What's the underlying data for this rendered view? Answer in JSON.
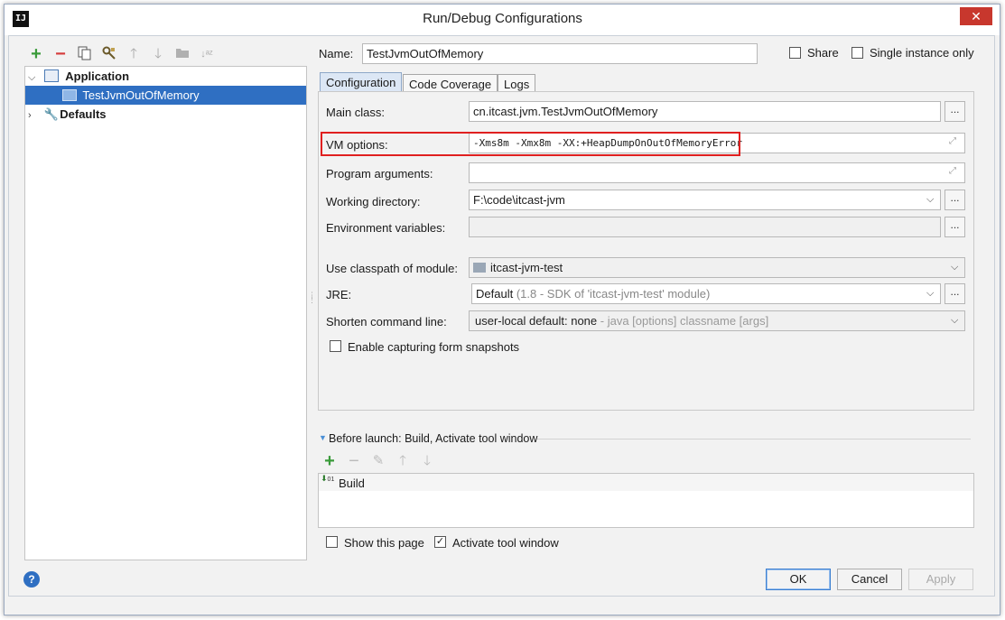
{
  "window": {
    "title": "Run/Debug Configurations",
    "app_icon_text": "IJ",
    "close_symbol": "✕"
  },
  "toolbar": {
    "icons": [
      "add-icon",
      "remove-icon",
      "copy-icon",
      "edit-defaults-icon",
      "move-up-icon",
      "move-down-icon",
      "folder-icon",
      "sort-icon"
    ]
  },
  "tree": {
    "application": "Application",
    "selected_item": "TestJvmOutOfMemory",
    "defaults": "Defaults"
  },
  "name_row": {
    "label": "Name:",
    "value": "TestJvmOutOfMemory",
    "share_label": "Share",
    "single_instance_label": "Single instance only"
  },
  "tabs": [
    "Configuration",
    "Code Coverage",
    "Logs"
  ],
  "config": {
    "main_class_label": "Main class:",
    "main_class_value": "cn.itcast.jvm.TestJvmOutOfMemory",
    "vm_options_label": "VM options:",
    "vm_options_value": "-Xms8m -Xmx8m -XX:+HeapDumpOnOutOfMemoryError",
    "program_args_label": "Program arguments:",
    "program_args_value": "",
    "working_dir_label": "Working directory:",
    "working_dir_value": "F:\\code\\itcast-jvm",
    "env_vars_label": "Environment variables:",
    "env_vars_value": "",
    "classpath_label": "Use classpath of module:",
    "classpath_value": "itcast-jvm-test",
    "jre_label": "JRE:",
    "jre_value_main": "Default",
    "jre_value_hint": "(1.8 - SDK of 'itcast-jvm-test' module)",
    "shorten_label": "Shorten command line:",
    "shorten_value_main": "user-local default: none",
    "shorten_value_hint": "- java [options] classname [args]",
    "capture_label": "Enable capturing form snapshots",
    "dots": "..."
  },
  "before_launch": {
    "header": "Before launch: Build, Activate tool window",
    "items": [
      "Build"
    ]
  },
  "bottom": {
    "show_page_label": "Show this page",
    "activate_window_label": "Activate tool window",
    "activate_window_checked": true,
    "ok": "OK",
    "cancel": "Cancel",
    "apply": "Apply",
    "help": "?"
  },
  "colors": {
    "selection": "#2f6fc2",
    "highlight_box": "#e02020",
    "add_green": "#3a9b3a",
    "remove_red": "#d63c3c"
  }
}
